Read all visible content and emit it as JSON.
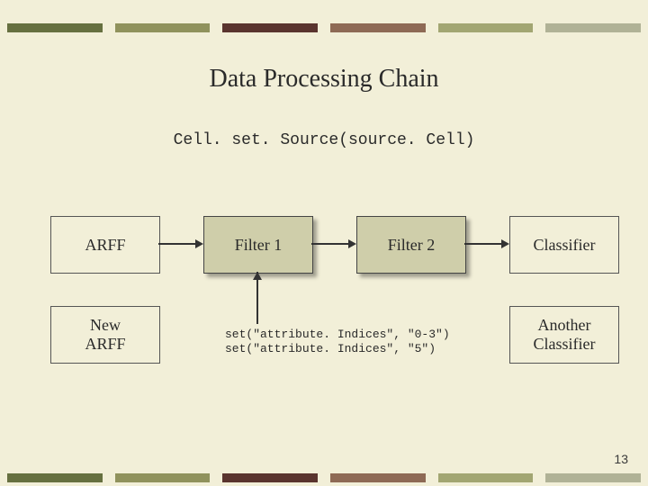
{
  "title": "Data Processing Chain",
  "subtitle": "Cell. set. Source(source. Cell)",
  "boxes": {
    "arff": "ARFF",
    "filter1": "Filter 1",
    "filter2": "Filter 2",
    "classifier": "Classifier",
    "new_arff": "New\nARFF",
    "another_classifier": "Another\nClassifier"
  },
  "code": {
    "line1": "set(\"attribute. Indices\", \"0-3\")",
    "line2": "set(\"attribute. Indices\", \"5\")"
  },
  "page_number": "13"
}
